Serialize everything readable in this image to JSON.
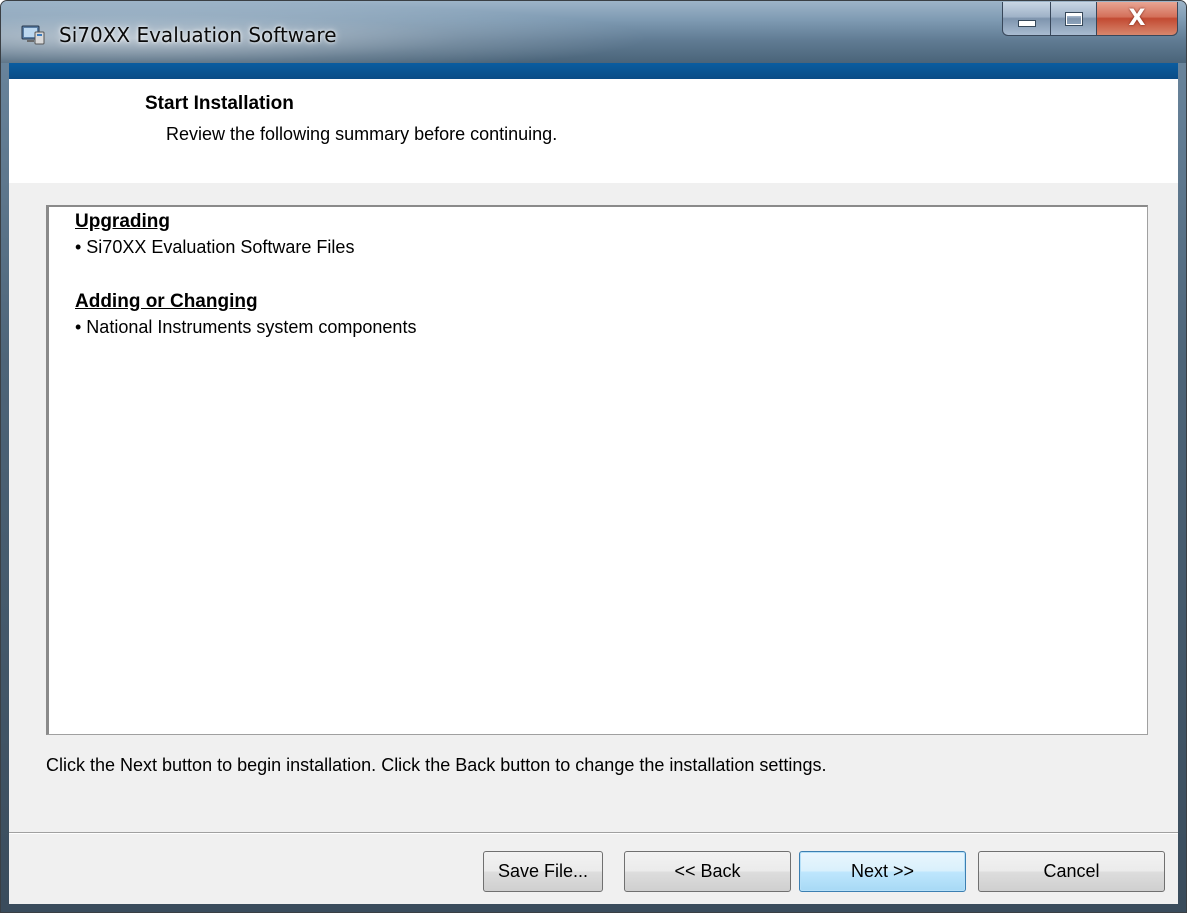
{
  "window": {
    "title": "Si70XX Evaluation Software",
    "caption_icons": [
      "minimize-icon",
      "maximize-icon",
      "close-icon"
    ],
    "close_glyph": "X"
  },
  "header": {
    "title": "Start Installation",
    "subtitle": "Review the following summary before continuing."
  },
  "summary": {
    "sections": [
      {
        "title": "Upgrading",
        "items": [
          "• Si70XX Evaluation Software Files"
        ]
      },
      {
        "title": "Adding or Changing",
        "items": [
          "• National Instruments system components"
        ]
      }
    ]
  },
  "instruction": "Click the Next button to begin installation.  Click the Back button to change the installation settings.",
  "buttons": {
    "save_file": "Save File...",
    "back": "<< Back",
    "next": "Next >>",
    "cancel": "Cancel"
  },
  "colors": {
    "accent_bar": "#0a4c86",
    "default_button_border": "#3c7fb1"
  }
}
